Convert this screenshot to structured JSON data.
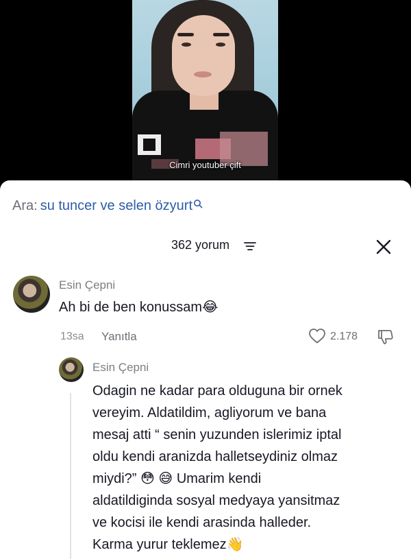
{
  "video": {
    "caption": "Cimri youtuber çift"
  },
  "search": {
    "label": "Ara:",
    "query": "su tuncer ve selen özyurt",
    "icon": "search-icon"
  },
  "comments_header": {
    "count_label": "362 yorum",
    "filter_icon": "filter-icon",
    "close_icon": "close-icon"
  },
  "comments": [
    {
      "author": "Esin Çepni",
      "text": "Ah bi de ben konussam😂",
      "time": "13sa",
      "reply_label": "Yanıtla",
      "likes": "2.178"
    },
    {
      "author": "Esin Çepni",
      "text": "Odagin ne kadar para olduguna bir ornek vereyim. Aldatildim, agliyorum ve bana mesaj atti “ senin yuzunden islerimiz iptal oldu kendi aranizda halletseydiniz olmaz miydi?” 😳 😅 Umarim kendi aldatildiginda sosyal medyaya yansitmaz ve kocisi ile kendi arasinda halleder. Karma yurur teklemez👋"
    }
  ],
  "colors": {
    "search_query": "#2c5da8",
    "secondary_text": "#7b7d82",
    "primary_text": "#161823"
  }
}
